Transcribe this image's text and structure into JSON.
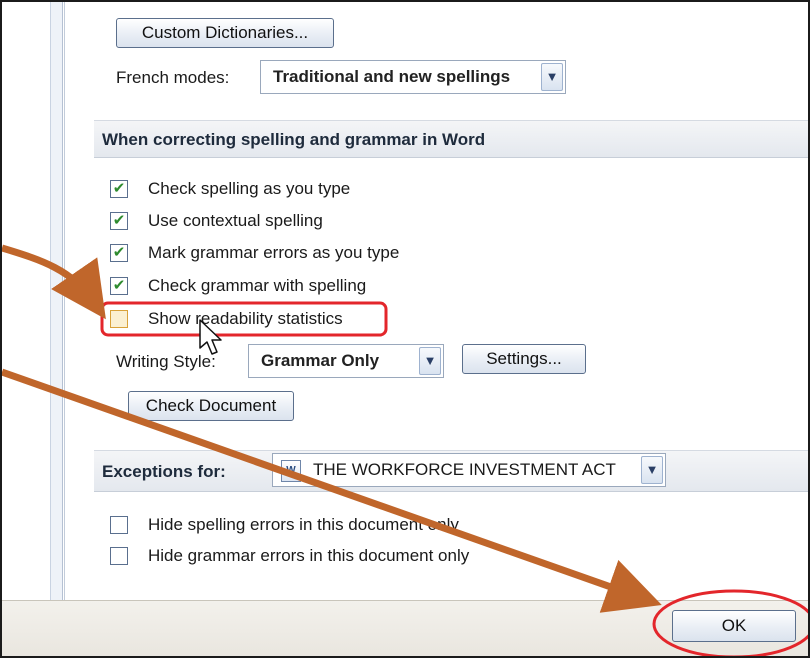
{
  "proofing": {
    "custom_dictionaries_label": "Custom Dictionaries...",
    "french_modes_label": "French modes:",
    "french_modes_value": "Traditional and new spellings"
  },
  "word_section": {
    "header": "When correcting spelling and grammar in Word",
    "options": [
      {
        "label": "Check spelling as you type",
        "checked": true
      },
      {
        "label": "Use contextual spelling",
        "checked": true
      },
      {
        "label": "Mark grammar errors as you type",
        "checked": true
      },
      {
        "label": "Check grammar with spelling",
        "checked": true
      },
      {
        "label": "Show readability statistics",
        "checked": false
      }
    ],
    "writing_style_label": "Writing Style:",
    "writing_style_value": "Grammar Only",
    "settings_label": "Settings...",
    "check_document_label": "Check Document"
  },
  "exceptions": {
    "label": "Exceptions for:",
    "document_value": "THE WORKFORCE INVESTMENT ACT",
    "doc_icon": "word-document-icon",
    "options": [
      {
        "label": "Hide spelling errors in this document only",
        "checked": false
      },
      {
        "label": "Hide grammar errors in this document only",
        "checked": false
      }
    ]
  },
  "footer": {
    "ok_label": "OK"
  },
  "annotations": {
    "arrow_color": "#c0662b",
    "highlight_color": "#e3262b"
  },
  "icons": {
    "check_glyph": "✔",
    "dropdown_glyph": "▼"
  }
}
